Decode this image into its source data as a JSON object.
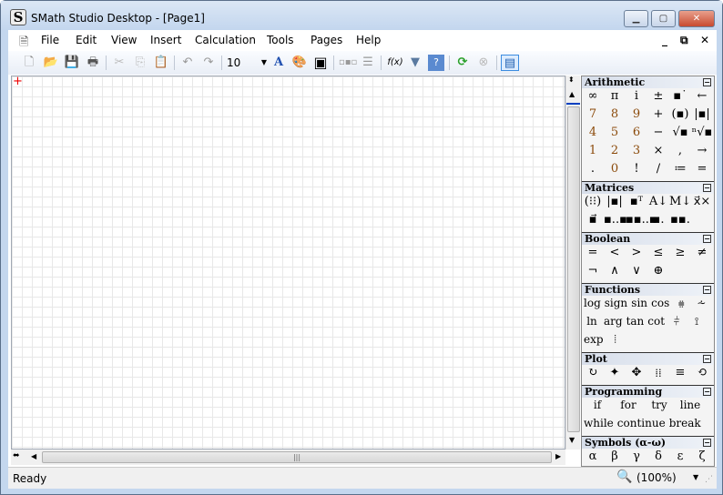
{
  "window": {
    "title": "SMath Studio Desktop - [Page1]",
    "icon_letter": "S"
  },
  "menu": [
    "File",
    "Edit",
    "View",
    "Insert",
    "Calculation",
    "Tools",
    "Pages",
    "Help"
  ],
  "toolbar": {
    "font_size": "10",
    "function_label": "f(x)"
  },
  "status": {
    "text": "Ready",
    "zoom": "(100%)"
  },
  "palette": [
    {
      "title": "Arithmetic",
      "type": "grid",
      "items": [
        "∞",
        "π",
        "i",
        "±",
        "▪˙",
        "←",
        "7",
        "8",
        "9",
        "+",
        "(▪)",
        "|▪|",
        "4",
        "5",
        "6",
        "−",
        "√▪",
        "ⁿ√▪",
        "1",
        "2",
        "3",
        "×",
        ",",
        "→",
        ".",
        "0",
        "!",
        "/",
        "≔",
        "="
      ]
    },
    {
      "title": "Matrices",
      "type": "grid",
      "items": [
        "(⁝⁝)",
        "|▪|",
        "▪ᵀ",
        "A↓",
        "M↓",
        "x⃗×",
        "▪⃗",
        "▪..▪",
        "▪▪..▪",
        "▪.",
        "▪▪."
      ]
    },
    {
      "title": "Boolean",
      "type": "grid",
      "items": [
        "=",
        "<",
        ">",
        "≤",
        "≥",
        "≠",
        "¬",
        "∧",
        "∨",
        "⊕"
      ]
    },
    {
      "title": "Functions",
      "type": "flex",
      "items": [
        "log",
        "sign",
        "sin",
        "cos",
        "⩷",
        "⩪",
        "ln",
        "arg",
        "tan",
        "cot",
        "⫩",
        "⟟",
        "exp",
        "⦙"
      ]
    },
    {
      "title": "Plot",
      "type": "grid",
      "items": [
        "↻",
        "✦",
        "✥",
        "⁞⁞",
        "≡",
        "⟲"
      ]
    },
    {
      "title": "Programming",
      "type": "flex",
      "items": [
        "if",
        "for",
        "try",
        "line",
        "while",
        "continue",
        "break"
      ]
    },
    {
      "title": "Symbols (α-ω)",
      "type": "grid",
      "items": [
        "α",
        "β",
        "γ",
        "δ",
        "ε",
        "ζ"
      ]
    }
  ],
  "colors": {
    "number": "#8b4a0a",
    "cursor": "#ee0000"
  }
}
